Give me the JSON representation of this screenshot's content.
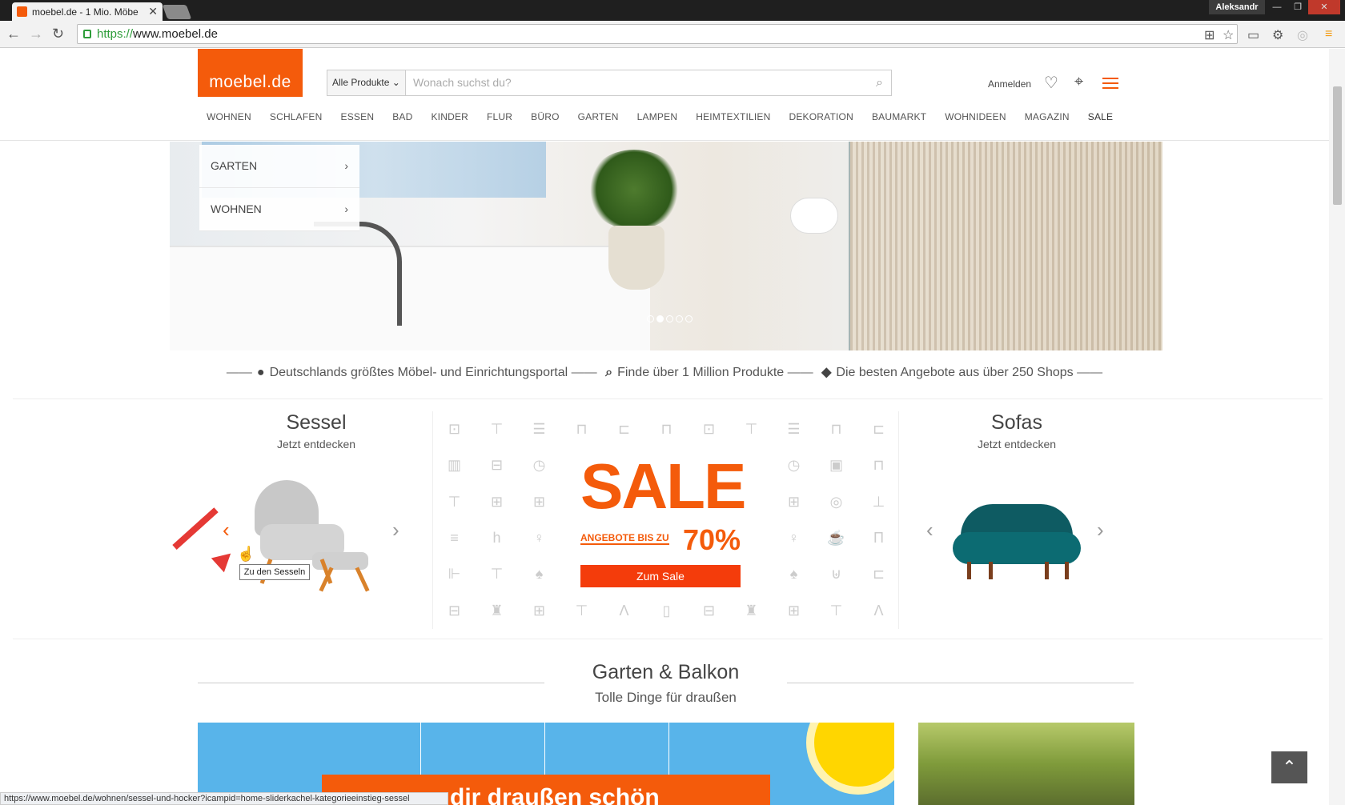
{
  "browser": {
    "tab_title": "moebel.de - 1 Mio. Möbe",
    "user": "Aleksandr",
    "url_scheme": "https://",
    "url_host": "www.moebel.de",
    "status_url": "https://www.moebel.de/wohnen/sessel-und-hocker?icampid=home-sliderkachel-kategorieeinstieg-sessel"
  },
  "header": {
    "logo": "moebel.de",
    "search_category": "Alle Produkte",
    "search_placeholder": "Wonach suchst du?",
    "login": "Anmelden"
  },
  "nav": [
    "WOHNEN",
    "SCHLAFEN",
    "ESSEN",
    "BAD",
    "KINDER",
    "FLUR",
    "BÜRO",
    "GARTEN",
    "LAMPEN",
    "HEIMTEXTILIEN",
    "DEKORATION",
    "BAUMARKT",
    "WOHNIDEEN",
    "MAGAZIN",
    "SALE"
  ],
  "hero_menu": [
    "GARTEN",
    "WOHNEN"
  ],
  "usp": {
    "item1": "Deutschlands größtes Möbel- und Einrichtungsportal",
    "item2": "Finde über 1 Million Produkte",
    "item3": "Die besten Angebote aus über 250 Shops"
  },
  "tiles": {
    "left_title": "Sessel",
    "left_sub": "Jetzt entdecken",
    "left_tooltip": "Zu den Sesseln",
    "right_title": "Sofas",
    "right_sub": "Jetzt entdecken"
  },
  "sale": {
    "headline": "SALE",
    "line": "ANGEBOTE BIS ZU",
    "percent": "70%",
    "button": "Zum Sale"
  },
  "section": {
    "title": "Garten & Balkon",
    "subtitle": "Tolle Dinge für draußen",
    "banner_text": "dir draußen schön"
  },
  "colors": {
    "brand": "#f45b0b",
    "sofa": "#0c6b72"
  }
}
